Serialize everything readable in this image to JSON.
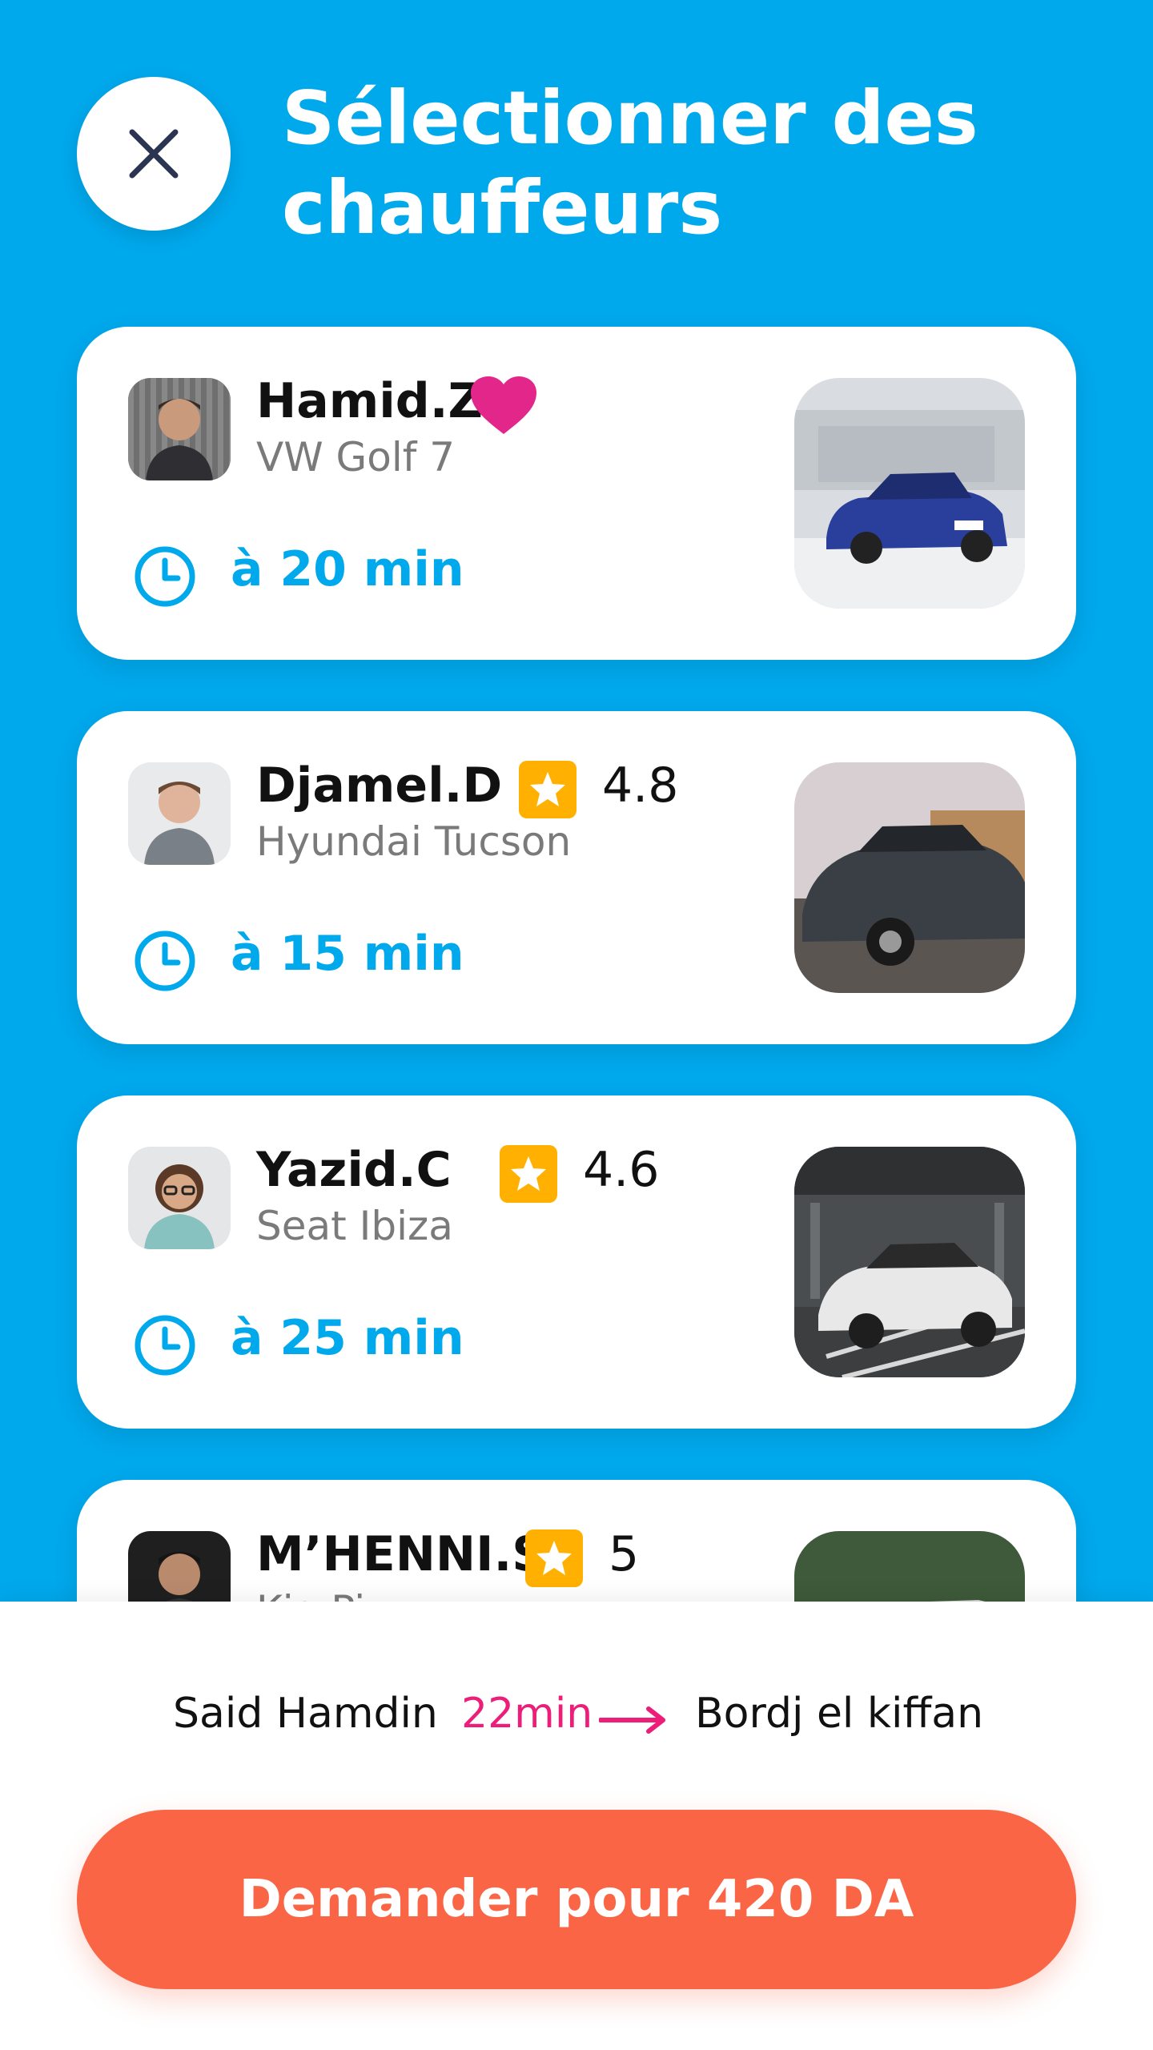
{
  "header": {
    "title_line1": "Sélectionner des",
    "title_line2": "chauffeurs",
    "close_icon": "close-icon"
  },
  "drivers": [
    {
      "name": "Hamid.Z",
      "car": "VW Golf 7",
      "eta": "à 20 min",
      "favorite": true,
      "rating": null,
      "car_color": "#2A3E9B"
    },
    {
      "name": "Djamel.D",
      "car": "Hyundai Tucson",
      "eta": "à 15 min",
      "favorite": false,
      "rating": "4.8",
      "car_color": "#3A3F46"
    },
    {
      "name": "Yazid.C",
      "car": "Seat Ibiza",
      "eta": "à 25 min",
      "favorite": false,
      "rating": "4.6",
      "car_color": "#E8E8E8"
    },
    {
      "name": "M’HENNI.S",
      "car": "Kia Pi",
      "eta": "",
      "favorite": false,
      "rating": "5",
      "car_color": "#D8D8D8"
    }
  ],
  "route": {
    "origin": "Said Hamdin",
    "duration": "22min",
    "destination": "Bordj el kiffan"
  },
  "action": {
    "request_label": "Demander pour 420 DA"
  },
  "colors": {
    "background": "#00A8EC",
    "accent_pink": "#EC1E79",
    "star_badge": "#FFB000",
    "primary_button": "#F96545"
  }
}
